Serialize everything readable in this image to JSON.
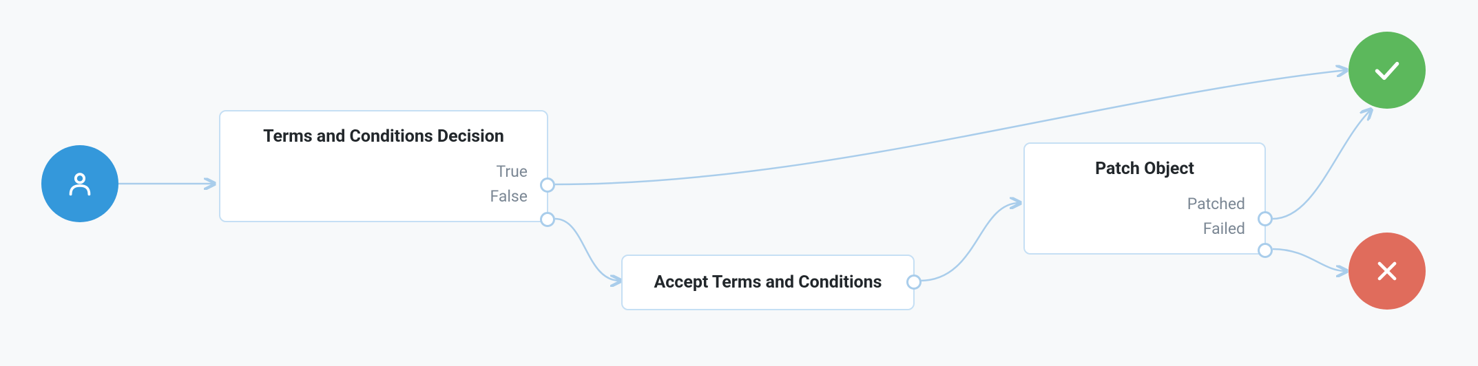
{
  "nodes": {
    "start": {
      "icon": "person-icon"
    },
    "decision": {
      "title": "Terms and Conditions Decision",
      "outputs": {
        "true": "True",
        "false": "False"
      }
    },
    "accept": {
      "title": "Accept Terms and Conditions"
    },
    "patch": {
      "title": "Patch Object",
      "outputs": {
        "patched": "Patched",
        "failed": "Failed"
      }
    },
    "success": {
      "icon": "check-icon"
    },
    "fail": {
      "icon": "x-icon"
    }
  },
  "colors": {
    "start": "#3498db",
    "success": "#5cb85c",
    "fail": "#e06c5c",
    "border": "#c5dff4",
    "connector": "#a9cdeb"
  }
}
